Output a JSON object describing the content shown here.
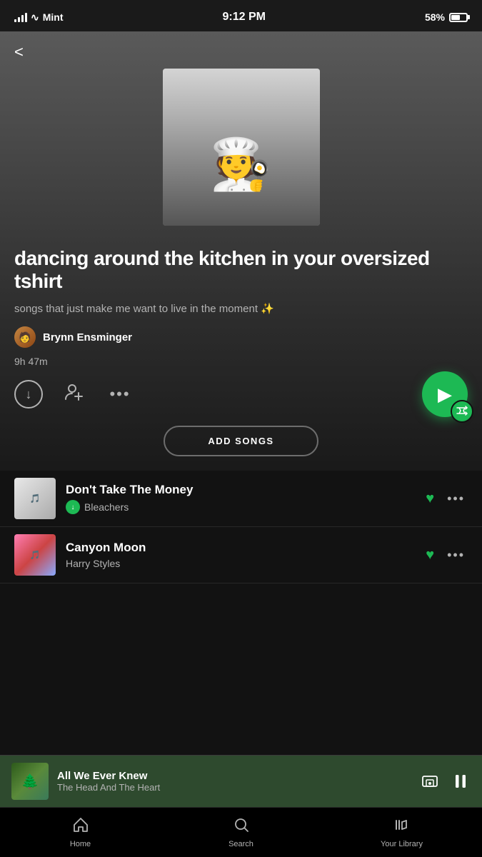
{
  "statusBar": {
    "carrier": "Mint",
    "time": "9:12 PM",
    "battery": "58%",
    "signal": 3,
    "wifi": true
  },
  "header": {
    "backLabel": "‹"
  },
  "playlist": {
    "title": "dancing around the kitchen in your oversized tshirt",
    "description": "songs that just make me want to live in the moment ✨",
    "creator": "Brynn Ensminger",
    "duration": "9h 47m"
  },
  "controls": {
    "downloadLabel": "↓",
    "addUserLabel": "👤+",
    "moreLabel": "...",
    "playLabel": "▶",
    "shuffleLabel": "⇄",
    "addSongsLabel": "ADD SONGS"
  },
  "tracks": [
    {
      "title": "Don't Take The Money",
      "artist": "Bleachers",
      "downloaded": true,
      "liked": true
    },
    {
      "title": "Canyon Moon",
      "artist": "Harry Styles",
      "downloaded": false,
      "liked": true
    }
  ],
  "nowPlaying": {
    "title": "All We Ever Knew",
    "artist": "The Head And The Heart"
  },
  "bottomNav": [
    {
      "icon": "⌂",
      "label": "Home",
      "active": false
    },
    {
      "icon": "○",
      "label": "Search",
      "active": false
    },
    {
      "icon": "≡|",
      "label": "Your Library",
      "active": false
    }
  ]
}
